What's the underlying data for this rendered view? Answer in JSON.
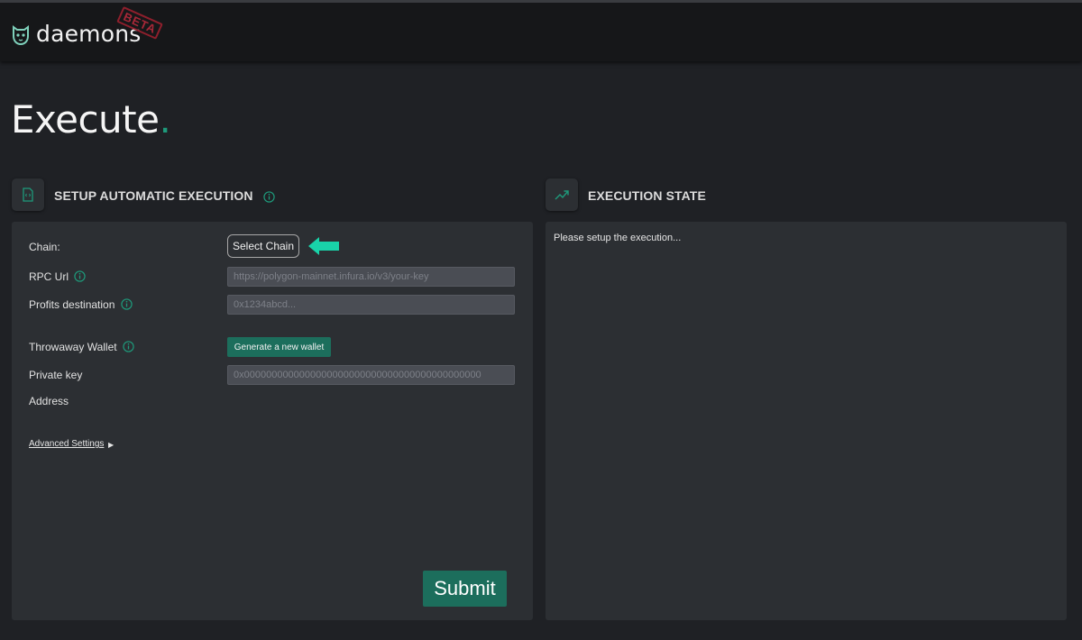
{
  "header": {
    "logo_text": "daemons",
    "beta_label": "BETA"
  },
  "page": {
    "title": "Execute",
    "title_dot": "."
  },
  "setup": {
    "heading": "SETUP AUTOMATIC EXECUTION",
    "chain_label": "Chain:",
    "select_chain_label": "Select Chain",
    "rpc_label": "RPC Url",
    "rpc_placeholder": "https://polygon-mainnet.infura.io/v3/your-key",
    "profits_label": "Profits destination",
    "profits_placeholder": "0x1234abcd...",
    "wallet_label": "Throwaway Wallet",
    "generate_label": "Generate a new wallet",
    "private_key_label": "Private key",
    "private_key_placeholder": "0x0000000000000000000000000000000000000000000",
    "address_label": "Address",
    "advanced_label": "Advanced Settings",
    "advanced_caret": "▶",
    "submit_label": "Submit"
  },
  "state": {
    "heading": "EXECUTION STATE",
    "message": "Please setup the execution..."
  },
  "colors": {
    "accent": "#1c6e5c",
    "arrow": "#19d3a9",
    "beta": "#a82838"
  }
}
